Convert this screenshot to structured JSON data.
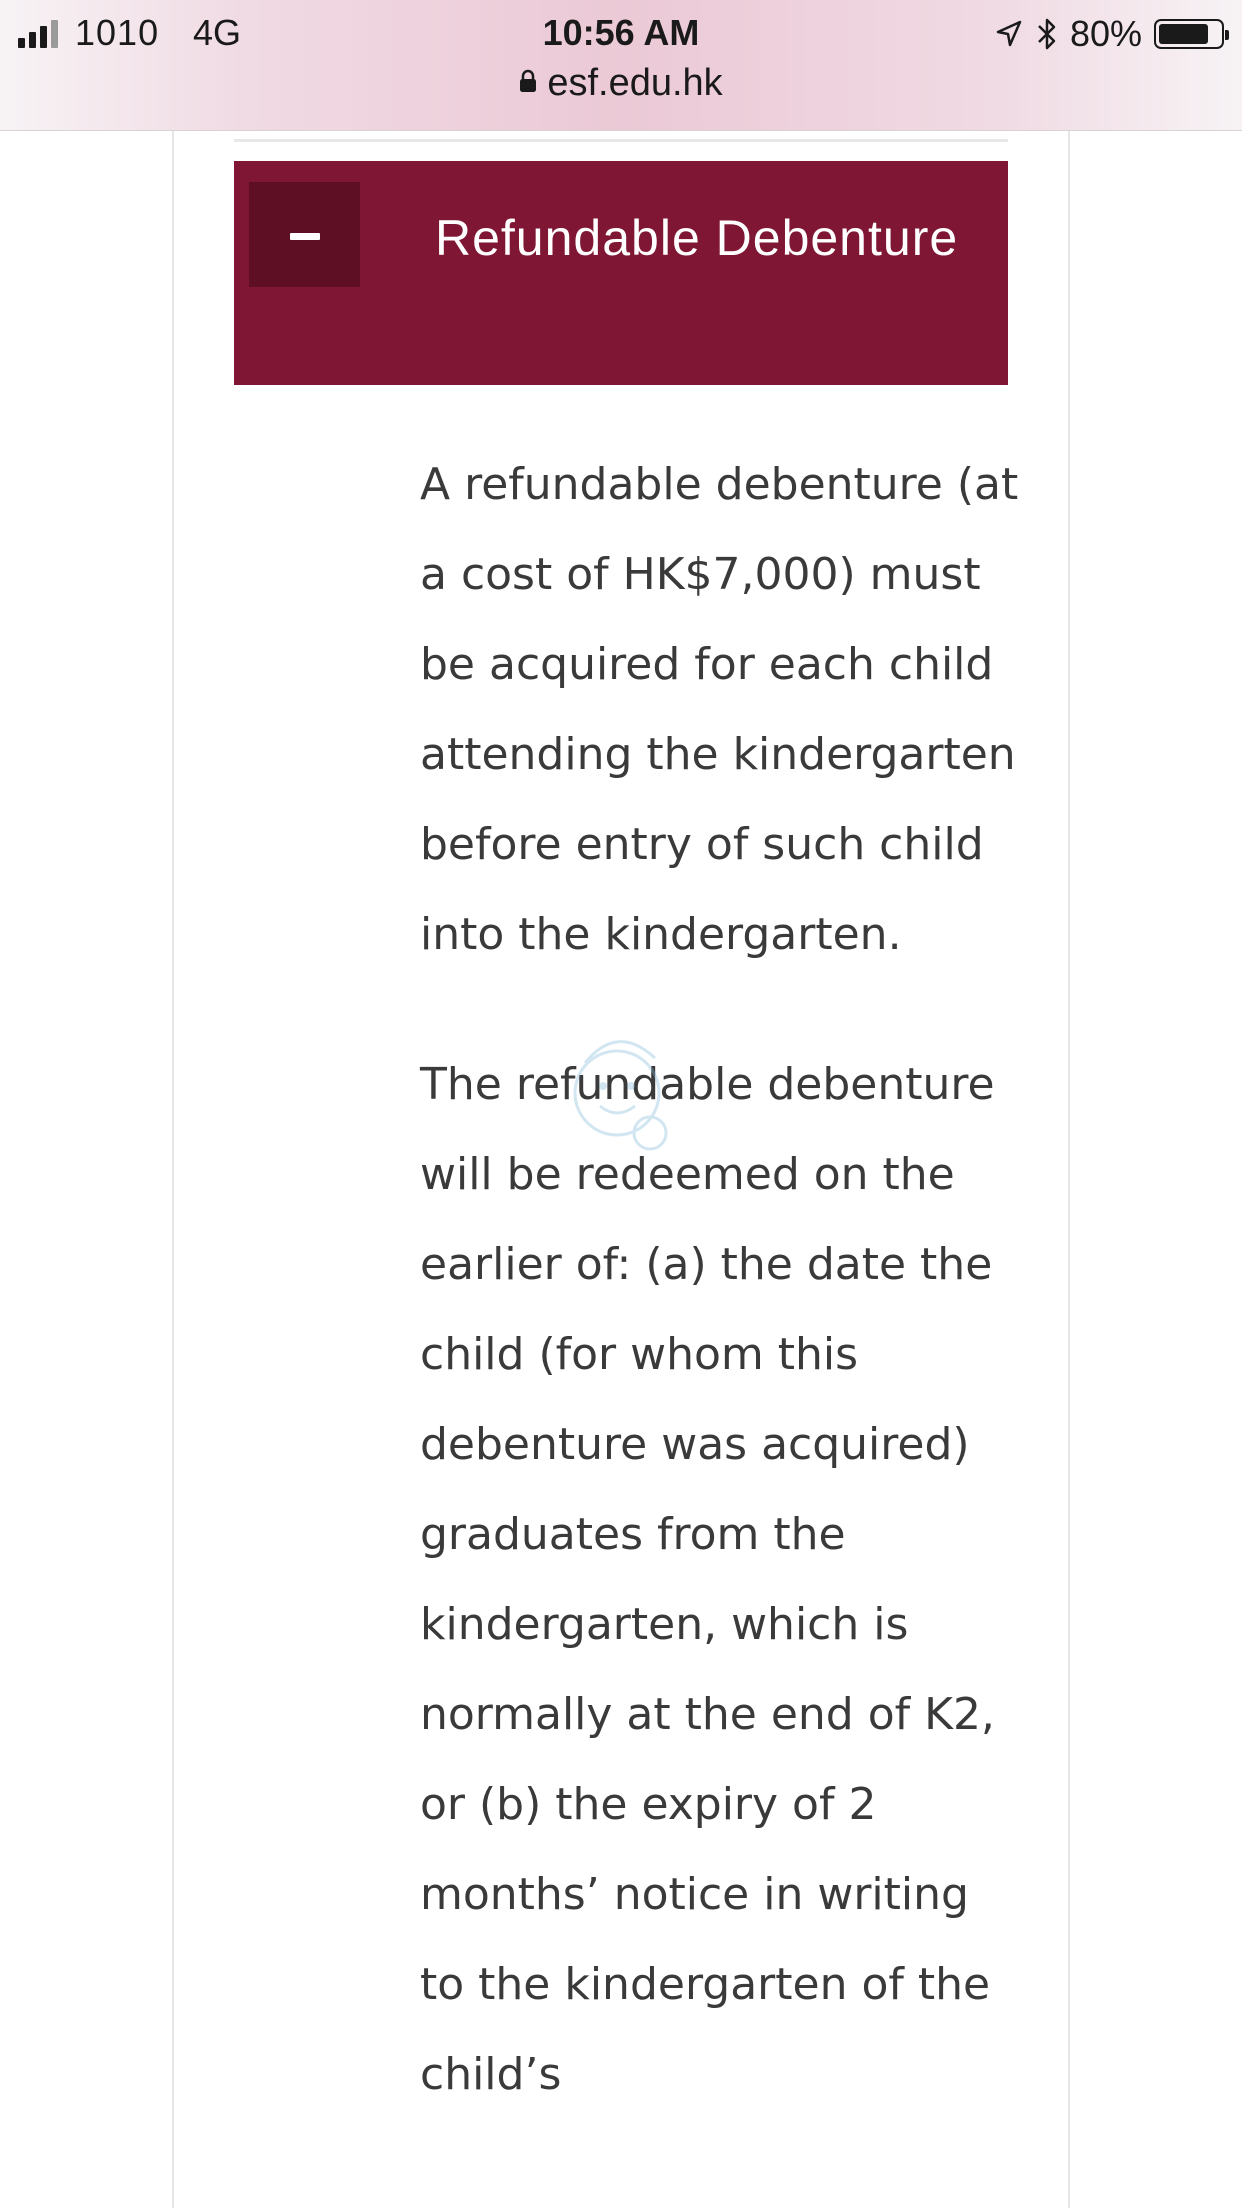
{
  "status_bar": {
    "carrier": "1010",
    "network": "4G",
    "time": "10:56 AM",
    "battery_percent": "80%",
    "battery_level": 0.8,
    "icons": [
      "signal-icon",
      "location-arrow-icon",
      "bluetooth-icon",
      "battery-icon"
    ]
  },
  "browser": {
    "url": "esf.edu.hk"
  },
  "accordion": {
    "title": "Refundable Debenture",
    "toggle_symbol": "minus",
    "expanded": true,
    "header_color": "#7f1734",
    "toggle_color": "#5e0f24"
  },
  "content": {
    "paragraphs": [
      "A refundable debenture (at a cost of HK$7,000) must be acquired for each child attending the kindergarten before entry of such child into the kindergarten.",
      "The refundable debenture will be redeemed on the earlier of: (a) the date the child (for whom this debenture was acquired) graduates from the kindergarten, which is normally at the end of K2, or (b) the expiry of 2 months’ notice in writing to the kindergarten of the child’s"
    ]
  }
}
